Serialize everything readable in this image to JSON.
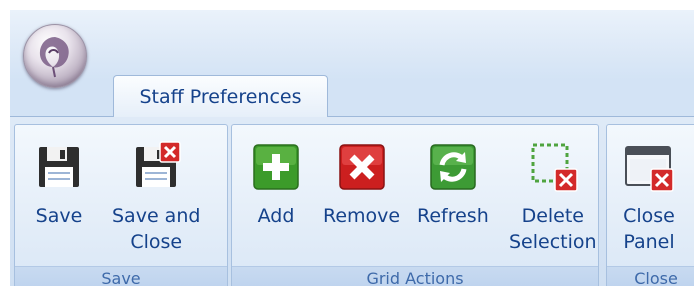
{
  "tab": {
    "label": "Staff Preferences"
  },
  "groups": {
    "save": {
      "label": "Save",
      "buttons": {
        "save": "Save",
        "save_close": "Save and\nClose"
      }
    },
    "grid": {
      "label": "Grid Actions",
      "buttons": {
        "add": "Add",
        "remove": "Remove",
        "refresh": "Refresh",
        "delete": "Delete\nSelection"
      }
    },
    "close": {
      "label": "Close",
      "buttons": {
        "close_panel": "Close\nPanel"
      }
    }
  },
  "colors": {
    "text": "#15428b",
    "group_label": "#3e6aaa",
    "add_green": "#3c9b2a",
    "remove_red": "#cc1f1f",
    "refresh_green": "#3d9b35"
  },
  "icons": [
    "app-orb-icon",
    "floppy-disk-icon",
    "floppy-disk-close-icon",
    "add-icon",
    "remove-icon",
    "refresh-icon",
    "delete-selection-icon",
    "close-panel-icon"
  ]
}
